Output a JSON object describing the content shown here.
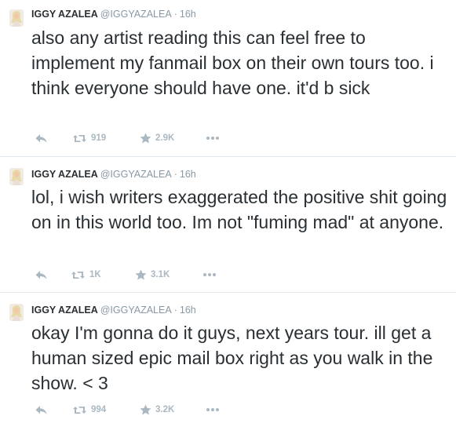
{
  "tweets": [
    {
      "fullname": "IGGY AZALEA",
      "username": "@IGGYAZALEA",
      "separator": "·",
      "time": "16h",
      "text": "also any artist reading this can feel free to implement my fanmail box on their own tours too. i think everyone should have one. it'd b sick",
      "retweets": "919",
      "favorites": "2.9K"
    },
    {
      "fullname": "IGGY AZALEA",
      "username": "@IGGYAZALEA",
      "separator": "·",
      "time": "16h",
      "text": "lol, i wish writers exaggerated the positive shit going on in this world too. Im not \"fuming mad\" at anyone.",
      "retweets": "1K",
      "favorites": "3.1K"
    },
    {
      "fullname": "IGGY AZALEA",
      "username": "@IGGYAZALEA",
      "separator": "·",
      "time": "16h",
      "text": "okay I'm gonna do it guys, next years tour. ill get a human sized epic mail box right as you walk in the show. < 3",
      "retweets": "994",
      "favorites": "3.2K"
    }
  ],
  "icons": {
    "reply": "reply-icon",
    "retweet": "retweet-icon",
    "favorite": "star-icon",
    "more": "more-icon",
    "avatar": "avatar-image"
  },
  "colors": {
    "text": "#292f33",
    "muted": "#8899a6",
    "action": "#aab8c2",
    "divider": "#e1e8ed"
  }
}
